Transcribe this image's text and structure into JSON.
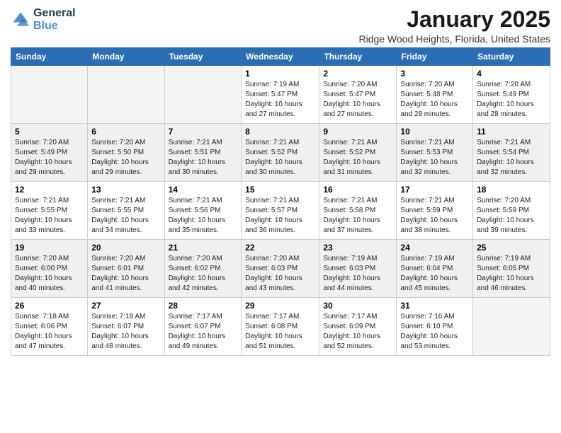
{
  "logo": {
    "line1": "General",
    "line2": "Blue"
  },
  "title": "January 2025",
  "location": "Ridge Wood Heights, Florida, United States",
  "weekdays": [
    "Sunday",
    "Monday",
    "Tuesday",
    "Wednesday",
    "Thursday",
    "Friday",
    "Saturday"
  ],
  "weeks": [
    [
      {
        "day": "",
        "info": ""
      },
      {
        "day": "",
        "info": ""
      },
      {
        "day": "",
        "info": ""
      },
      {
        "day": "1",
        "info": "Sunrise: 7:19 AM\nSunset: 5:47 PM\nDaylight: 10 hours\nand 27 minutes."
      },
      {
        "day": "2",
        "info": "Sunrise: 7:20 AM\nSunset: 5:47 PM\nDaylight: 10 hours\nand 27 minutes."
      },
      {
        "day": "3",
        "info": "Sunrise: 7:20 AM\nSunset: 5:48 PM\nDaylight: 10 hours\nand 28 minutes."
      },
      {
        "day": "4",
        "info": "Sunrise: 7:20 AM\nSunset: 5:49 PM\nDaylight: 10 hours\nand 28 minutes."
      }
    ],
    [
      {
        "day": "5",
        "info": "Sunrise: 7:20 AM\nSunset: 5:49 PM\nDaylight: 10 hours\nand 29 minutes."
      },
      {
        "day": "6",
        "info": "Sunrise: 7:20 AM\nSunset: 5:50 PM\nDaylight: 10 hours\nand 29 minutes."
      },
      {
        "day": "7",
        "info": "Sunrise: 7:21 AM\nSunset: 5:51 PM\nDaylight: 10 hours\nand 30 minutes."
      },
      {
        "day": "8",
        "info": "Sunrise: 7:21 AM\nSunset: 5:52 PM\nDaylight: 10 hours\nand 30 minutes."
      },
      {
        "day": "9",
        "info": "Sunrise: 7:21 AM\nSunset: 5:52 PM\nDaylight: 10 hours\nand 31 minutes."
      },
      {
        "day": "10",
        "info": "Sunrise: 7:21 AM\nSunset: 5:53 PM\nDaylight: 10 hours\nand 32 minutes."
      },
      {
        "day": "11",
        "info": "Sunrise: 7:21 AM\nSunset: 5:54 PM\nDaylight: 10 hours\nand 32 minutes."
      }
    ],
    [
      {
        "day": "12",
        "info": "Sunrise: 7:21 AM\nSunset: 5:55 PM\nDaylight: 10 hours\nand 33 minutes."
      },
      {
        "day": "13",
        "info": "Sunrise: 7:21 AM\nSunset: 5:55 PM\nDaylight: 10 hours\nand 34 minutes."
      },
      {
        "day": "14",
        "info": "Sunrise: 7:21 AM\nSunset: 5:56 PM\nDaylight: 10 hours\nand 35 minutes."
      },
      {
        "day": "15",
        "info": "Sunrise: 7:21 AM\nSunset: 5:57 PM\nDaylight: 10 hours\nand 36 minutes."
      },
      {
        "day": "16",
        "info": "Sunrise: 7:21 AM\nSunset: 5:58 PM\nDaylight: 10 hours\nand 37 minutes."
      },
      {
        "day": "17",
        "info": "Sunrise: 7:21 AM\nSunset: 5:59 PM\nDaylight: 10 hours\nand 38 minutes."
      },
      {
        "day": "18",
        "info": "Sunrise: 7:20 AM\nSunset: 5:59 PM\nDaylight: 10 hours\nand 39 minutes."
      }
    ],
    [
      {
        "day": "19",
        "info": "Sunrise: 7:20 AM\nSunset: 6:00 PM\nDaylight: 10 hours\nand 40 minutes."
      },
      {
        "day": "20",
        "info": "Sunrise: 7:20 AM\nSunset: 6:01 PM\nDaylight: 10 hours\nand 41 minutes."
      },
      {
        "day": "21",
        "info": "Sunrise: 7:20 AM\nSunset: 6:02 PM\nDaylight: 10 hours\nand 42 minutes."
      },
      {
        "day": "22",
        "info": "Sunrise: 7:20 AM\nSunset: 6:03 PM\nDaylight: 10 hours\nand 43 minutes."
      },
      {
        "day": "23",
        "info": "Sunrise: 7:19 AM\nSunset: 6:03 PM\nDaylight: 10 hours\nand 44 minutes."
      },
      {
        "day": "24",
        "info": "Sunrise: 7:19 AM\nSunset: 6:04 PM\nDaylight: 10 hours\nand 45 minutes."
      },
      {
        "day": "25",
        "info": "Sunrise: 7:19 AM\nSunset: 6:05 PM\nDaylight: 10 hours\nand 46 minutes."
      }
    ],
    [
      {
        "day": "26",
        "info": "Sunrise: 7:18 AM\nSunset: 6:06 PM\nDaylight: 10 hours\nand 47 minutes."
      },
      {
        "day": "27",
        "info": "Sunrise: 7:18 AM\nSunset: 6:07 PM\nDaylight: 10 hours\nand 48 minutes."
      },
      {
        "day": "28",
        "info": "Sunrise: 7:17 AM\nSunset: 6:07 PM\nDaylight: 10 hours\nand 49 minutes."
      },
      {
        "day": "29",
        "info": "Sunrise: 7:17 AM\nSunset: 6:08 PM\nDaylight: 10 hours\nand 51 minutes."
      },
      {
        "day": "30",
        "info": "Sunrise: 7:17 AM\nSunset: 6:09 PM\nDaylight: 10 hours\nand 52 minutes."
      },
      {
        "day": "31",
        "info": "Sunrise: 7:16 AM\nSunset: 6:10 PM\nDaylight: 10 hours\nand 53 minutes."
      },
      {
        "day": "",
        "info": ""
      }
    ]
  ]
}
